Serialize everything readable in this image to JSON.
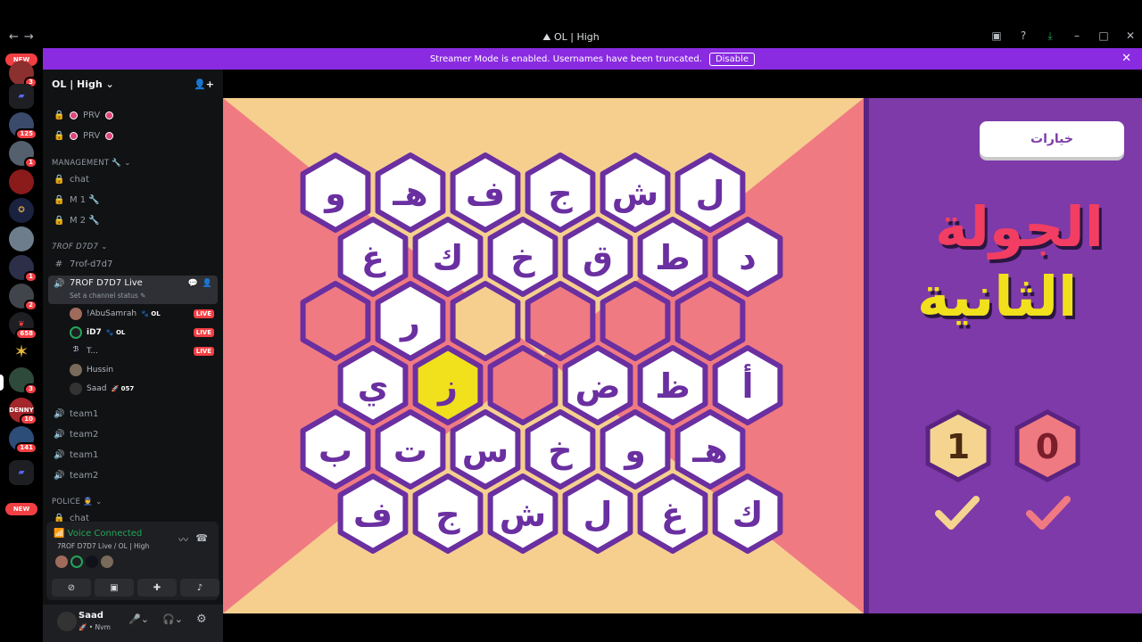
{
  "titlebar": {
    "title": "OL | High"
  },
  "banner": {
    "text": "Streamer Mode is enabled. Usernames have been truncated.",
    "button": "Disable"
  },
  "rail": {
    "new_label": "NEW",
    "badges": [
      "3",
      "125",
      "1",
      "1",
      "2",
      "658",
      "3",
      "10",
      "141"
    ]
  },
  "server": {
    "name": "OL | High"
  },
  "channels": {
    "prv1": "PRV",
    "prv2": "PRV",
    "cat_management": "MANAGEMENT 🔧",
    "chat": "chat",
    "m1": "M 1 🔧",
    "m2": "M 2 🔧",
    "cat_trof": "7ROF D7D7",
    "trof_text": "7rof-d7d7",
    "live_channel": "7ROF D7D7 Live",
    "live_status": "Set a channel status",
    "users": [
      {
        "name": "!AbuSamrah",
        "tag": "OL",
        "live": "LIVE"
      },
      {
        "name": "iD7",
        "tag": "OL",
        "live": "LIVE"
      },
      {
        "name": "T...",
        "tag": "",
        "live": "LIVE"
      },
      {
        "name": "Hussin",
        "tag": "",
        "live": ""
      },
      {
        "name": "Saad",
        "tag": "057",
        "live": ""
      }
    ],
    "team1a": "team1",
    "team2a": "team2",
    "team1b": "team1",
    "team2b": "team2",
    "cat_police": "POLICE 👮",
    "police_chat": "chat"
  },
  "voice": {
    "status": "Voice Connected",
    "sub": "7ROF D7D7 Live / OL | High"
  },
  "userbar": {
    "name": "Saad",
    "status": "Nvm"
  },
  "game": {
    "rows": [
      [
        "و",
        "هـ",
        "ف",
        "ج",
        "ش",
        "ل"
      ],
      [
        "غ",
        "ك",
        "خ",
        "ق",
        "ط",
        "د"
      ],
      [
        "",
        "ر",
        "",
        "",
        "",
        ""
      ],
      [
        "ي",
        "ز",
        "",
        "ض",
        "ظ",
        "أ"
      ],
      [
        "ب",
        "ت",
        "س",
        "خ",
        "و",
        "هـ"
      ],
      [
        "ف",
        "ج",
        "ش",
        "ل",
        "غ",
        "ك"
      ]
    ],
    "row_states": [
      [
        "w",
        "w",
        "w",
        "w",
        "w",
        "w"
      ],
      [
        "w",
        "w",
        "w",
        "w",
        "w",
        "w"
      ],
      [
        "p",
        "w",
        "o",
        "p",
        "p",
        "p"
      ],
      [
        "w",
        "y",
        "p",
        "w",
        "w",
        "w"
      ],
      [
        "w",
        "w",
        "w",
        "w",
        "w",
        "w"
      ],
      [
        "w",
        "w",
        "w",
        "w",
        "w",
        "w"
      ]
    ],
    "options_label": "خيارات",
    "round_line1": "الجولة",
    "round_line2": "الثانية",
    "score_left": "1",
    "score_right": "0",
    "colors": {
      "pink": "#f07a82",
      "peach": "#f6cf8f",
      "purple": "#7d3aa8",
      "yellow": "#f1e01c",
      "outline": "#6a2fa0"
    }
  }
}
